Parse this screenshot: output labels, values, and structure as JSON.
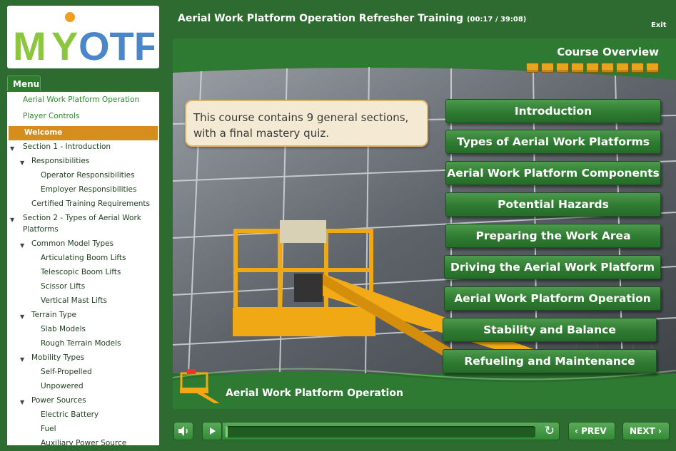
{
  "logo": {
    "text": "MYOTF"
  },
  "header": {
    "title": "Aerial Work Platform Operation Refresher Training",
    "time": "(00:17 / 39:08)",
    "exit_label": "Exit"
  },
  "menu": {
    "tab_label": "Menu",
    "items": [
      {
        "label": "Aerial Work Platform Operation"
      },
      {
        "label": "Player Controls"
      },
      {
        "label": "Welcome"
      },
      {
        "label": "Section 1 - Introduction"
      },
      {
        "label": "Responsibilities"
      },
      {
        "label": "Operator Responsibilities"
      },
      {
        "label": "Employer Responsibilities"
      },
      {
        "label": "Certified Training Requirements"
      },
      {
        "label": "Section 2 - Types of Aerial Work"
      },
      {
        "label": "Platforms"
      },
      {
        "label": "Common Model Types"
      },
      {
        "label": "Articulating Boom Lifts"
      },
      {
        "label": "Telescopic Boom Lifts"
      },
      {
        "label": "Scissor Lifts"
      },
      {
        "label": "Vertical Mast Lifts"
      },
      {
        "label": "Terrain Type"
      },
      {
        "label": "Slab Models"
      },
      {
        "label": "Rough Terrain Models"
      },
      {
        "label": "Mobility Types"
      },
      {
        "label": "Self-Propelled"
      },
      {
        "label": "Unpowered"
      },
      {
        "label": "Power Sources"
      },
      {
        "label": "Electric Battery"
      },
      {
        "label": "Fuel"
      },
      {
        "label": "Auxiliary Power Source"
      }
    ]
  },
  "slide": {
    "heading": "Course Overview",
    "progress_squares": 9,
    "callout": "This course contains 9 general sections, with a final mastery quiz.",
    "sections": [
      "Introduction",
      "Types of Aerial Work Platforms",
      "Aerial Work Platform Components",
      "Potential Hazards",
      "Preparing the Work Area",
      "Driving the Aerial Work Platform",
      "Aerial Work Platform Operation",
      "Stability and Balance",
      "Refueling and Maintenance"
    ],
    "footer_title": "Aerial Work Platform Operation"
  },
  "controls": {
    "progress": 0.007,
    "prev_label": "PREV",
    "next_label": "NEXT"
  },
  "colors": {
    "background": "#2e6b31",
    "accent_orange": "#d58e1c",
    "button_green": "#2f7b32"
  }
}
